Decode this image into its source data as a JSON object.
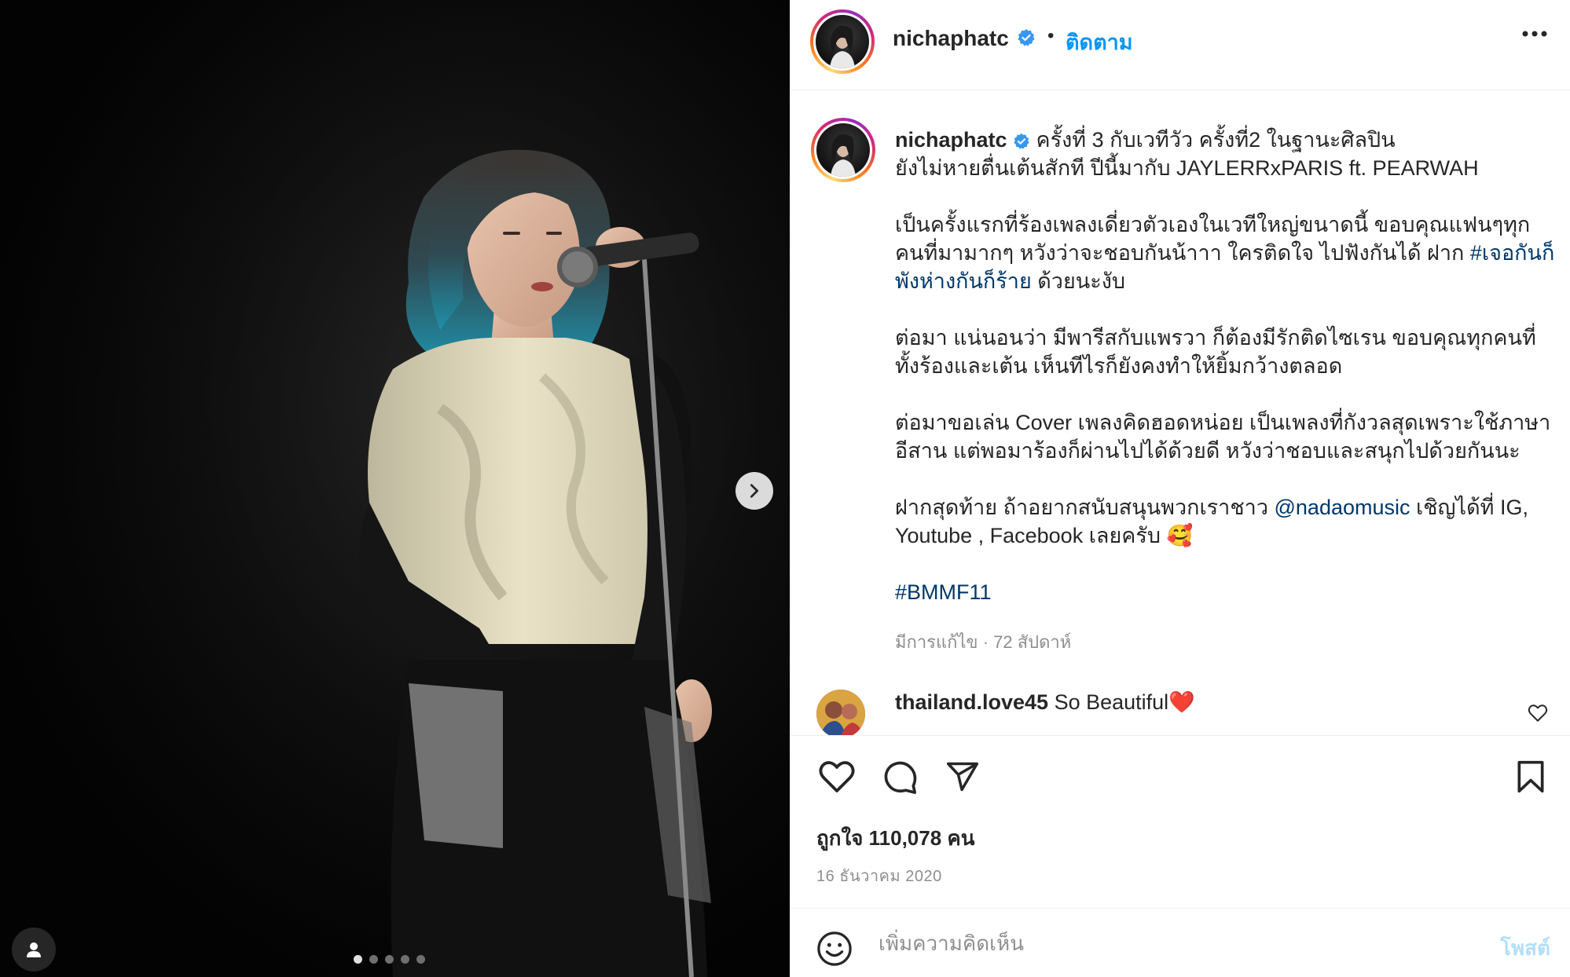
{
  "post": {
    "username": "nichaphatc",
    "follow_label": "ติดตาม",
    "separator": "•",
    "verified": true,
    "colors": {
      "accent": "#0095f6",
      "hashtag": "#00376b",
      "muted": "#8e8e8e",
      "post_disabled": "#b2dffc",
      "like_red": "#ed4956"
    }
  },
  "media": {
    "slide_count": 5,
    "active_slide": 1,
    "icons": {
      "next": "chevron-right-icon",
      "tags": "user-tag-icon"
    }
  },
  "caption": {
    "username": "nichaphatc",
    "line1": " ครั้งที่ 3 กับเวทีวัว ครั้งที่2 ในฐานะศิลปิน",
    "line2": "ยังไม่หายตื่นเต้นสักที ปีนี้มากับ JAYLERRxPARIS ft. PEARWAH",
    "p2_text": "เป็นครั้งแรกที่ร้องเพลงเดี่ยวตัวเองในเวทีใหญ่ขนาดนี้ ขอบคุณแฟนๆทุกคนที่มามากๆ หวังว่าจะชอบกันน้าาา ใครติดใจ ไปฟังกันได้ ฝาก ",
    "p2_tag": "#เจอกันก็พังห่างกันก็ร้าย",
    "p2_tail": " ด้วยนะงับ",
    "p3": "ต่อมา แน่นอนว่า มีพารีสกับแพรวา ก็ต้องมีรักติดไซเรน ขอบคุณทุกคนที่ทั้งร้องและเต้น เห็นทีไรก็ยังคงทำให้ยิ้มกว้างตลอด",
    "p4": "ต่อมาขอเล่น Cover เพลงคิดฮอดหน่อย เป็นเพลงที่กังวลสุดเพราะใช้ภาษาอีสาน แต่พอมาร้องก็ผ่านไปได้ด้วยดี หวังว่าชอบและสนุกไปด้วยกันนะ",
    "p5_pre": "ฝากสุดท้าย ถ้าอยากสนับสนุนพวกเราชาว ",
    "p5_mention": "@nadaomusic",
    "p5_post": " เชิญได้ที่ IG, Youtube , Facebook เลยครับ 🥰",
    "hashtag": "#BMMF11",
    "meta": "มีการแก้ไข · 72 สัปดาห์"
  },
  "comment": {
    "username": "thailand.love45",
    "text": " So Beautiful❤️"
  },
  "actions": {
    "icons": [
      "heart-icon",
      "comment-icon",
      "share-icon",
      "bookmark-icon"
    ],
    "likes_text": "ถูกใจ 110,078 คน",
    "date": "16 ธันวาคม 2020"
  },
  "add_comment": {
    "placeholder": "เพิ่มความคิดเห็น",
    "post_label": "โพสต์",
    "icon": "emoji-icon"
  }
}
